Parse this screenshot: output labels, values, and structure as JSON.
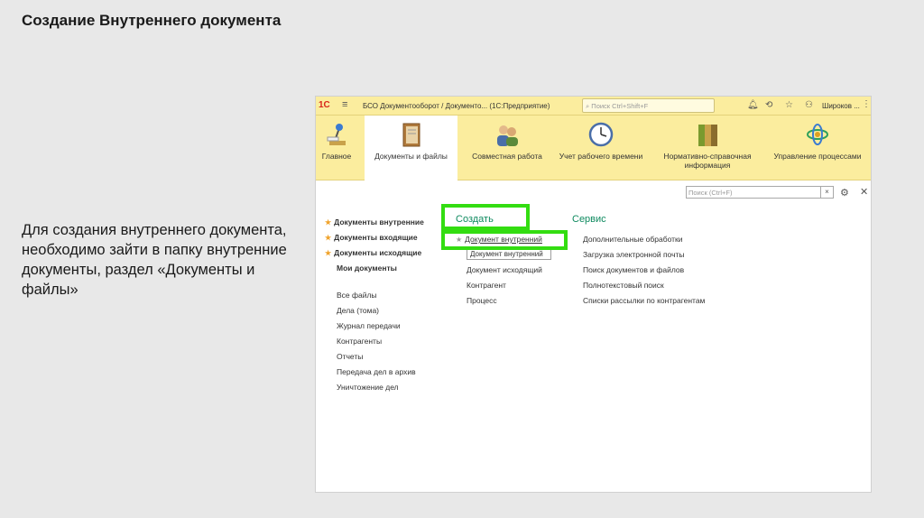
{
  "slide": {
    "title": "Создание Внутреннего документа",
    "body": "Для создания внутреннего документа, необходимо зайти в папку внутренние документы, раздел «Документы и файлы»"
  },
  "titlebar": {
    "logo": "1С",
    "menu_icon": "hamburger-menu-icon",
    "title": "БСО Документооборот / Документо... (1С:Предприятие)",
    "search_placeholder": "Поиск Ctrl+Shift+F",
    "user": "Широков ...",
    "icons": [
      "search-icon",
      "bell-icon",
      "history-icon",
      "star-icon",
      "user-icon",
      "more-icon"
    ]
  },
  "sections": [
    {
      "label": "Главное",
      "icon": "desk-lamp-icon"
    },
    {
      "label": "Документы и файлы",
      "icon": "folder-icon",
      "active": true
    },
    {
      "label": "Совместная работа",
      "icon": "people-icon"
    },
    {
      "label": "Учет рабочего времени",
      "icon": "clock-icon"
    },
    {
      "label": "Нормативно-справочная информация",
      "icon": "binders-icon"
    },
    {
      "label": "Управление процессами",
      "icon": "process-icon"
    }
  ],
  "panel": {
    "search_placeholder": "Поиск (Ctrl+F)",
    "clear_label": "×"
  },
  "nav": {
    "favorites": [
      "Документы внутренние",
      "Документы входящие",
      "Документы исходящие"
    ],
    "my_documents": "Мои документы",
    "items": [
      "Все файлы",
      "Дела (тома)",
      "Журнал передачи",
      "Контрагенты",
      "Отчеты",
      "Передача дел в архив",
      "Уничтожение дел"
    ]
  },
  "create": {
    "heading": "Создать",
    "items": [
      "Документ внутренний",
      "Документ исходящий",
      "Контрагент",
      "Процесс"
    ],
    "tooltip": "Документ внутренний"
  },
  "service": {
    "heading": "Сервис",
    "items": [
      "Дополнительные обработки",
      "Загрузка электронной почты",
      "Поиск документов и файлов",
      "Полнотекстовый поиск",
      "Списки рассылки по контрагентам"
    ]
  },
  "colors": {
    "toolbar": "#fbed9e",
    "accent_green": "#0e8a5f",
    "highlight": "#33dd11",
    "favorite_star": "#f0a32c"
  }
}
